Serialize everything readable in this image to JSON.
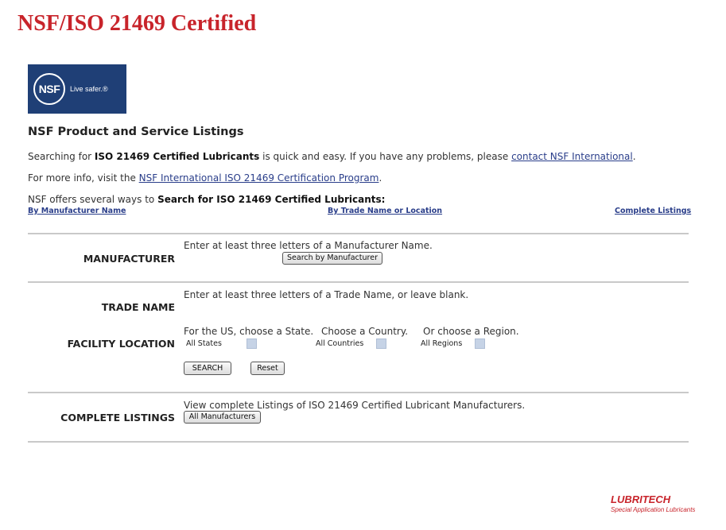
{
  "header": {
    "title": "NSF/ISO 21469 Certified"
  },
  "logo": {
    "mark": "NSF",
    "tagline": "Live safer.®"
  },
  "intro": {
    "section_title": "NSF Product and Service Listings",
    "line1_pre": "Searching for ",
    "line1_bold": "ISO 21469 Certified Lubricants",
    "line1_mid": " is quick and easy. If you have any problems, please ",
    "line1_link": "contact NSF International",
    "line1_post": ".",
    "line2_pre": "For more info, visit the ",
    "line2_link": "NSF International ISO 21469 Certification Program",
    "line2_post": ".",
    "line3_pre": "NSF offers several ways to ",
    "line3_bold": "Search for ISO 21469 Certified Lubricants:"
  },
  "nav_links": {
    "by_manufacturer": "By Manufacturer Name",
    "by_trade_name": "By Trade Name or Location",
    "complete": "Complete Listings"
  },
  "manufacturer": {
    "label": "MANUFACTURER",
    "instruction": "Enter at least three letters of a Manufacturer Name.",
    "button": "Search by Manufacturer"
  },
  "trade_name": {
    "label": "TRADE NAME",
    "instruction": "Enter at least three letters of a Trade Name, or leave blank."
  },
  "facility": {
    "label": "FACILITY LOCATION",
    "state_prompt": "For the US, choose a State.",
    "country_prompt": "Choose a Country.",
    "region_prompt": "Or choose a Region.",
    "state_value": "All States",
    "country_value": "All Countries",
    "region_value": "All Regions",
    "search_button": "SEARCH",
    "reset_button": "Reset"
  },
  "complete_listings": {
    "label": "COMPLETE LISTINGS",
    "instruction": "View complete Listings of ISO 21469 Certified Lubricant Manufacturers.",
    "button": "All Manufacturers"
  },
  "footer": {
    "brand": "LUBRITECH",
    "brand_sub": "Special Application Lubricants"
  }
}
